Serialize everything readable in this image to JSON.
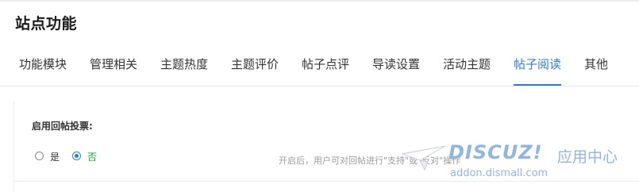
{
  "page": {
    "title": "站点功能"
  },
  "tabs": [
    {
      "label": "功能模块",
      "active": false
    },
    {
      "label": "管理相关",
      "active": false
    },
    {
      "label": "主题热度",
      "active": false
    },
    {
      "label": "主题评价",
      "active": false
    },
    {
      "label": "帖子点评",
      "active": false
    },
    {
      "label": "导读设置",
      "active": false
    },
    {
      "label": "活动主题",
      "active": false
    },
    {
      "label": "帖子阅读",
      "active": true
    },
    {
      "label": "其他",
      "active": false
    }
  ],
  "setting": {
    "label": "启用回帖投票:",
    "options": [
      {
        "label": "是",
        "checked": false
      },
      {
        "label": "否",
        "checked": true
      }
    ],
    "hint": "开启后，用户可对回帖进行\"支持\"或\"反对\"操作"
  },
  "watermark": {
    "brand": "DISCUZ!",
    "cn": "应用中心",
    "url": "addon.dismall.com"
  },
  "colors": {
    "accent": "#2a7fd4",
    "selected_option": "#1a9c3a"
  }
}
